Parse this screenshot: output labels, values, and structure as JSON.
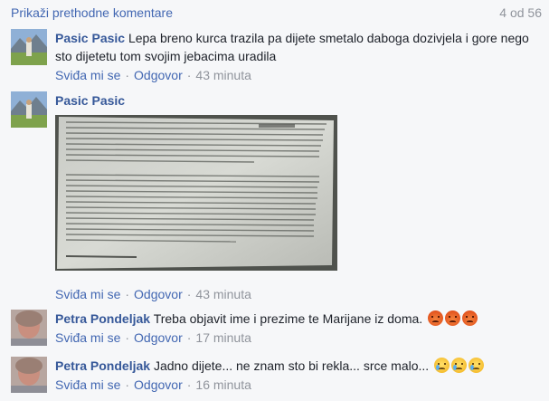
{
  "header": {
    "prev_comments_label": "Prikaži prethodne komentare",
    "counter": "4 od 56"
  },
  "actions_common": {
    "like": "Sviđa mi se",
    "reply": "Odgovor",
    "sep": "·"
  },
  "comments": [
    {
      "author": "Pasic Pasic",
      "text": "Lepa breno kurca trazila pa dijete smetalo daboga dozivjela i gore nego sto dijetetu tom svojim jebacima uradila",
      "time": "43 minuta",
      "avatar": "landscape-avatar"
    },
    {
      "author": "Pasic Pasic",
      "text": "",
      "attachment": "photo-of-printed-article",
      "time": "43 minuta",
      "avatar": "landscape-avatar"
    },
    {
      "author": "Petra Pondeljak",
      "text": "Treba objavit ime i prezime te Marijane iz doma.",
      "emojis": [
        "angry-face-emoji",
        "angry-face-emoji",
        "angry-face-emoji"
      ],
      "time": "17 minuta",
      "avatar": "portrait-avatar"
    },
    {
      "author": "Petra Pondeljak",
      "text": "Jadno dijete... ne znam sto bi rekla... srce malo...",
      "emojis": [
        "crying-face-emoji",
        "crying-face-emoji",
        "crying-face-emoji"
      ],
      "time": "16 minuta",
      "avatar": "portrait-avatar"
    }
  ],
  "colors": {
    "link": "#4267b2",
    "author": "#365899",
    "meta": "#90949c",
    "background": "#f6f7f9"
  }
}
